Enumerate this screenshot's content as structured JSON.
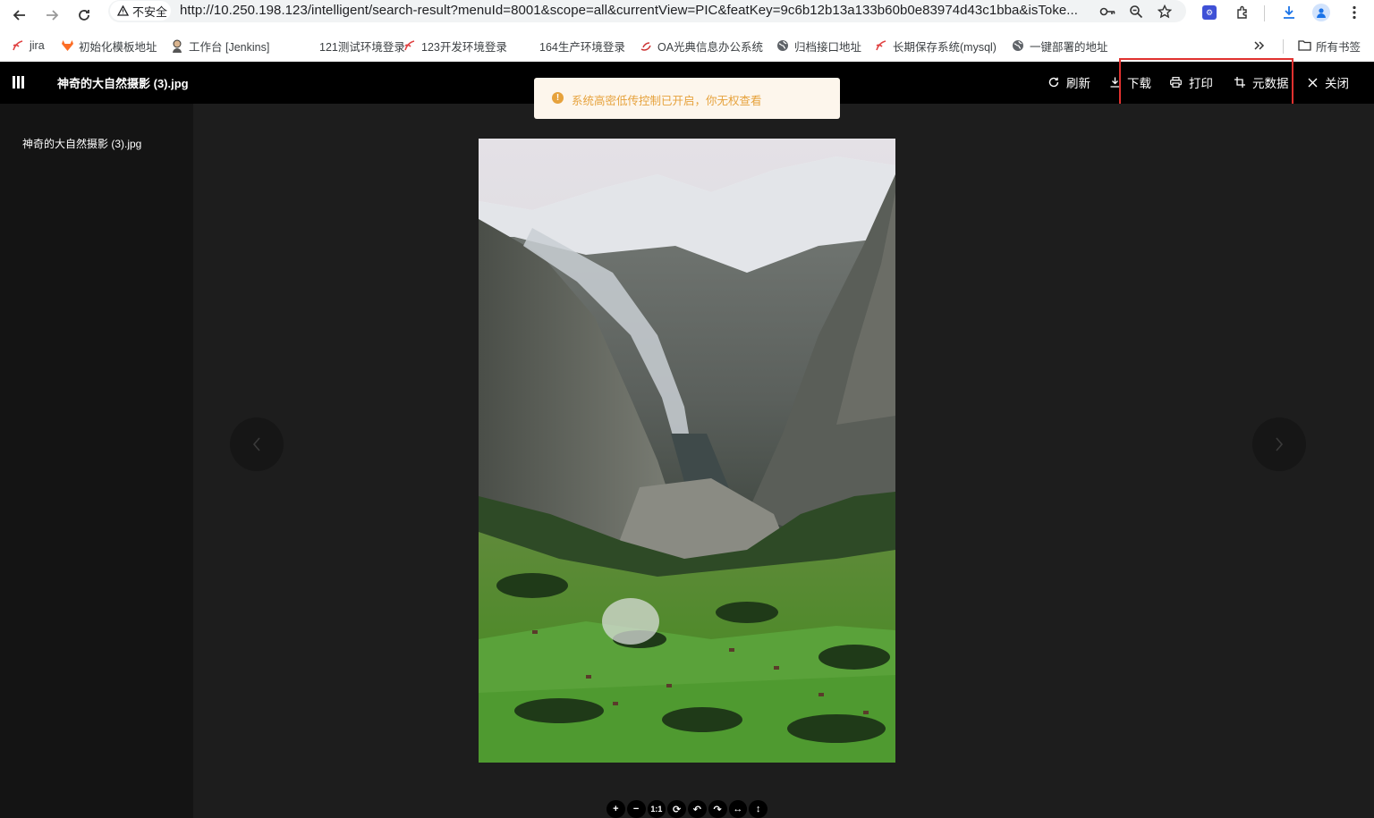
{
  "browser": {
    "security_label": "不安全",
    "url": "http://10.250.198.123/intelligent/search-result?menuId=8001&scope=all&currentView=PIC&featKey=9c6b12b13a133b60b0e83974d43c1bba&isToke...",
    "bookmarks": [
      {
        "label": "jira",
        "icon": "jira-icon"
      },
      {
        "label": "初始化模板地址",
        "icon": "gitlab-icon"
      },
      {
        "label": "工作台 [Jenkins]",
        "icon": "jenkins-icon"
      },
      {
        "label": "121测试环境登录",
        "icon": ""
      },
      {
        "label": "123开发环境登录",
        "icon": "jira-icon"
      },
      {
        "label": "164生产环境登录",
        "icon": ""
      },
      {
        "label": "OA光典信息办公系统",
        "icon": "oa-icon"
      },
      {
        "label": "归档接口地址",
        "icon": "globe-icon"
      },
      {
        "label": "长期保存系统(mysql)",
        "icon": "jira-icon"
      },
      {
        "label": "一键部署的地址",
        "icon": "globe-icon"
      }
    ],
    "all_bookmarks": "所有书签"
  },
  "header": {
    "file_title": "神奇的大自然摄影 (3).jpg",
    "refresh": "刷新",
    "download": "下载",
    "print": "打印",
    "metadata": "元数据",
    "close": "关闭"
  },
  "sidebar": {
    "items": [
      "神奇的大自然摄影 (3).jpg"
    ]
  },
  "toast": {
    "message": "系统高密低传控制已开启，你无权查看"
  },
  "toolbar": {
    "tools": [
      "+",
      "−",
      "1:1",
      "⟳",
      "↶",
      "↷",
      "↔",
      "↕"
    ]
  },
  "colors": {
    "header_bg": "#000000",
    "toast_bg": "#fdf6ec",
    "toast_text": "#e6a23c",
    "highlight": "#e0312f"
  }
}
